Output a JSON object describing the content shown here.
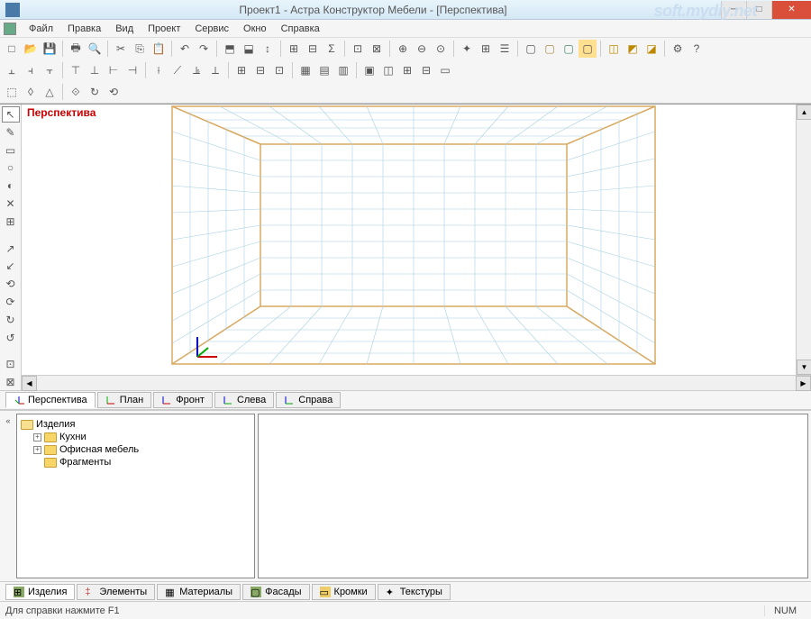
{
  "title": "Проект1 - Астра Конструктор Мебели - [Перспектива]",
  "watermark": "soft.mydiy.net",
  "menu": [
    "Файл",
    "Правка",
    "Вид",
    "Проект",
    "Сервис",
    "Окно",
    "Справка"
  ],
  "viewport_label": "Перспектива",
  "view_tabs": [
    "Перспектива",
    "План",
    "Фронт",
    "Слева",
    "Справа"
  ],
  "tree": {
    "root": "Изделия",
    "children": [
      {
        "label": "Кухни",
        "expandable": true
      },
      {
        "label": "Офисная мебель",
        "expandable": true
      },
      {
        "label": "Фрагменты",
        "expandable": false
      }
    ]
  },
  "bottom_tabs": [
    "Изделия",
    "Элементы",
    "Материалы",
    "Фасады",
    "Кромки",
    "Текстуры"
  ],
  "status": {
    "help": "Для справки нажмите F1",
    "num": "NUM"
  }
}
